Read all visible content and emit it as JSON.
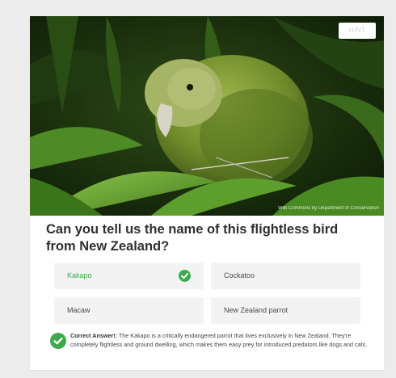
{
  "hint_label": "HINT",
  "photo": {
    "credit": "Wiki Commons by Department of Conservation"
  },
  "question": "Can you tell us the name of this flightless bird from New Zealand?",
  "options": [
    {
      "label": "Kakapo",
      "state": "correct"
    },
    {
      "label": "Cockatoo",
      "state": "default"
    },
    {
      "label": "Macaw",
      "state": "default"
    },
    {
      "label": "New Zealand parrot",
      "state": "default"
    }
  ],
  "answer": {
    "prefix": "Correct Answer!:",
    "text": " The Kakapo is a critically endangered parrot that lives exclusively in New Zealand. They're completely flightless and ground dwelling, which makes them easy prey for introduced predators like dogs and cats."
  },
  "colors": {
    "correct": "#3eaa4c",
    "option_bg": "#f3f3f3",
    "page_bg": "#ececec"
  },
  "icons": {
    "option_check": "check-icon",
    "answer_badge": "check-circle-icon"
  }
}
